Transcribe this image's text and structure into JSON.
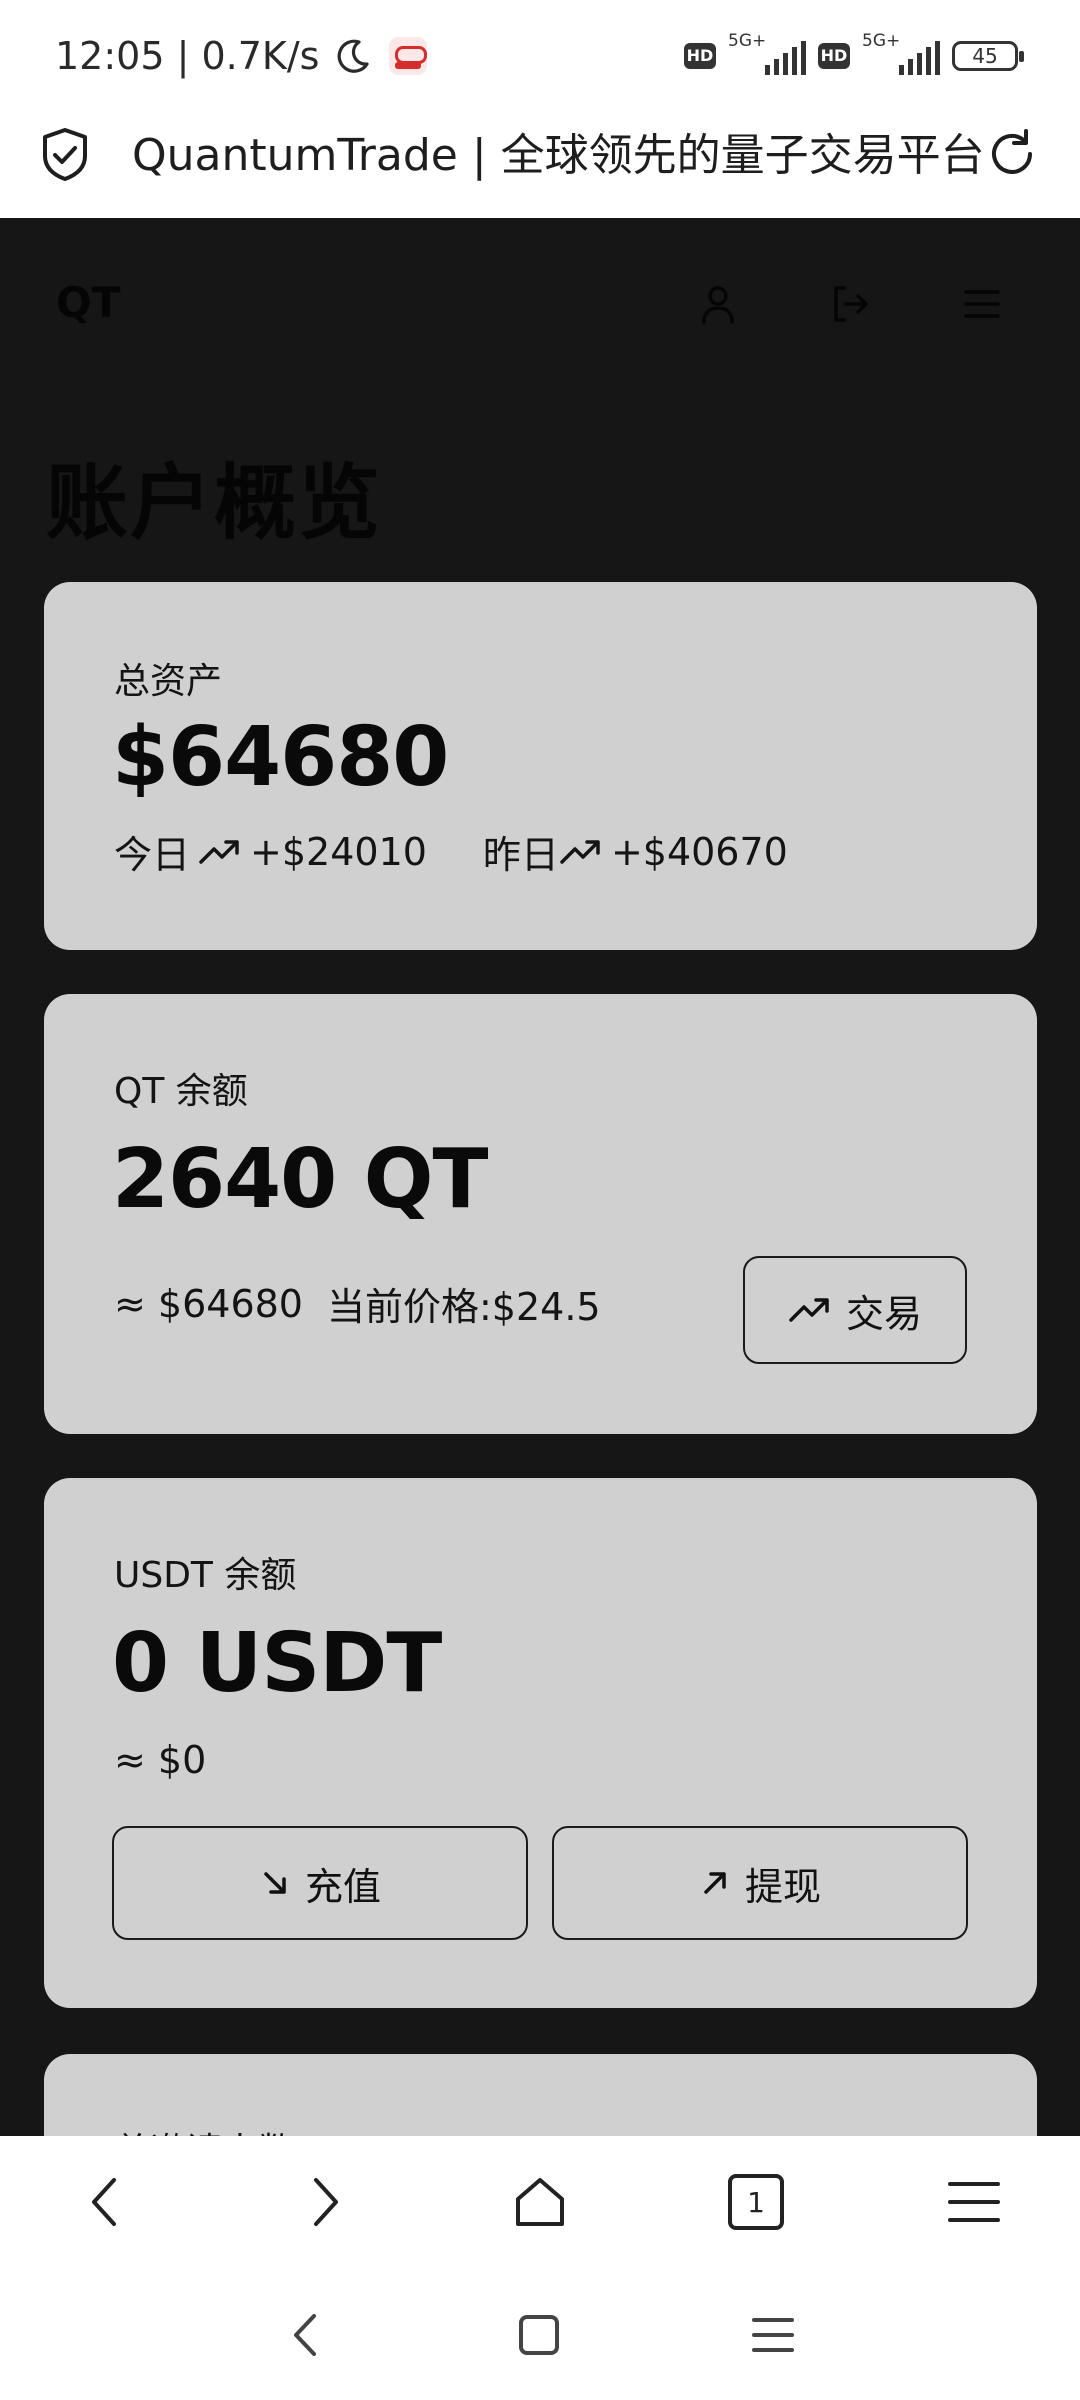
{
  "status_bar": {
    "time_speed": "12:05 | 0.7K/s",
    "hd_label": "HD",
    "signal_label": "5G+",
    "battery": "45"
  },
  "browser": {
    "page_title": "QuantumTrade | 全球领先的量子交易平台"
  },
  "site": {
    "logo": "QT",
    "heading": "账户概览"
  },
  "cards": {
    "total": {
      "label": "总资产",
      "amount": "$64680",
      "today_label": "今日",
      "today_value": "+$24010",
      "yesterday_label": "昨日",
      "yesterday_value": "+$40670"
    },
    "qt": {
      "label": "QT 余额",
      "amount": "2640 QT",
      "approx": "≈ $64680",
      "price": "当前价格:$24.5",
      "trade_label": "交易"
    },
    "usdt": {
      "label": "USDT 余额",
      "amount": "0 USDT",
      "approx": "≈ $0",
      "deposit_label": "充值",
      "withdraw_label": "提现"
    },
    "invites": {
      "label": "总邀请人数"
    }
  },
  "toolbar": {
    "tab_count": "1"
  },
  "colors": {
    "page_bg": "#161616",
    "card_bg": "#d0d0d0",
    "text": "#0c0c0c"
  }
}
